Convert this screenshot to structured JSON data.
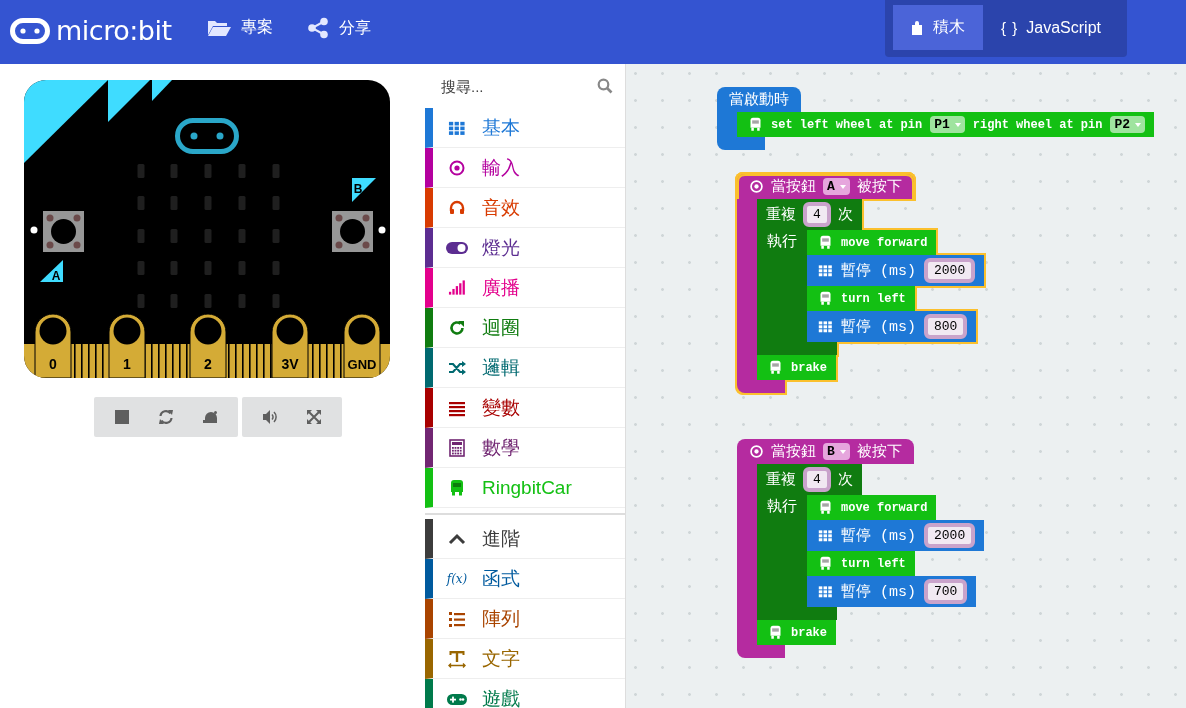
{
  "header": {
    "logo": "micro:bit",
    "menu": [
      {
        "kind": "folder",
        "label": "專案"
      },
      {
        "kind": "share",
        "label": "分享"
      }
    ],
    "editor_tabs": [
      {
        "kind": "blocks",
        "label": "積木",
        "selected": true
      },
      {
        "kind": "javascript",
        "icon_text": "{ }",
        "label": "JavaScript",
        "selected": false
      }
    ]
  },
  "simulator": {
    "buttons": [
      {
        "label": "A"
      },
      {
        "label": "B"
      }
    ],
    "pins": [
      "0",
      "1",
      "2",
      "3V",
      "GND"
    ],
    "toolbar_groups": [
      {
        "buttons": [
          {
            "kind": "stop"
          },
          {
            "kind": "restart"
          },
          {
            "kind": "slow"
          }
        ]
      },
      {
        "buttons": [
          {
            "kind": "sound"
          },
          {
            "kind": "fullscreen"
          }
        ]
      }
    ]
  },
  "toolbox": {
    "search": {
      "placeholder": "搜尋..."
    },
    "categories": [
      {
        "kind": "grid",
        "label": "基本",
        "color": "#1e78d6"
      },
      {
        "kind": "target",
        "label": "輸入",
        "color": "#b4009e"
      },
      {
        "kind": "headphones",
        "label": "音效",
        "color": "#d83b01"
      },
      {
        "kind": "toggle",
        "label": "燈光",
        "color": "#5c2d91"
      },
      {
        "kind": "signal",
        "label": "廣播",
        "color": "#e3008c"
      },
      {
        "kind": "refresh",
        "label": "迴圈",
        "color": "#107c10"
      },
      {
        "kind": "shuffle",
        "label": "邏輯",
        "color": "#006970"
      },
      {
        "kind": "lines",
        "label": "變數",
        "color": "#a80000"
      },
      {
        "kind": "calculator",
        "label": "數學",
        "color": "#712672"
      },
      {
        "kind": "car",
        "label": "RingbitCar",
        "color": "#13c013"
      }
    ],
    "advanced": [
      {
        "kind": "chevron",
        "label": "進階",
        "color": "#3c3c3c"
      },
      {
        "kind": "function",
        "icon_text": "f(x)",
        "label": "函式",
        "color": "#005a9e"
      },
      {
        "kind": "list",
        "label": "陣列",
        "color": "#a94400"
      },
      {
        "kind": "text",
        "label": "文字",
        "color": "#996600"
      },
      {
        "kind": "gamepad",
        "label": "遊戲",
        "color": "#007a4b"
      }
    ]
  },
  "workspace": {
    "scripts": [
      {
        "kind": "start_hat",
        "selected": false,
        "header": [
          {
            "kind": "text",
            "value": "當啟動時"
          }
        ],
        "body": [
          {
            "kind": "car_block",
            "parts": [
              {
                "kind": "text",
                "value": "set left wheel at pin"
              },
              {
                "kind": "dropdown",
                "value": "P1"
              },
              {
                "kind": "text",
                "value": "right wheel at pin"
              },
              {
                "kind": "dropdown",
                "value": "P2"
              }
            ]
          }
        ]
      },
      {
        "kind": "button_hat",
        "selected": true,
        "header": [
          {
            "kind": "text",
            "value": "當按鈕"
          },
          {
            "kind": "dropdown",
            "value": "A"
          },
          {
            "kind": "text",
            "value": "被按下"
          }
        ],
        "body": [
          {
            "kind": "loop",
            "header": [
              {
                "kind": "text",
                "value": "重複"
              },
              {
                "kind": "number",
                "value": "4"
              },
              {
                "kind": "text",
                "value": "次"
              }
            ],
            "do_label": "執行",
            "body": [
              {
                "kind": "car_block",
                "parts": [
                  {
                    "kind": "text",
                    "value": "move forward"
                  }
                ]
              },
              {
                "kind": "basic_block",
                "parts": [
                  {
                    "kind": "text",
                    "value": "暫停 (ms)"
                  },
                  {
                    "kind": "number",
                    "value": "2000"
                  }
                ]
              },
              {
                "kind": "car_block",
                "parts": [
                  {
                    "kind": "text",
                    "value": "turn left"
                  }
                ]
              },
              {
                "kind": "basic_block",
                "parts": [
                  {
                    "kind": "text",
                    "value": "暫停 (ms)"
                  },
                  {
                    "kind": "number",
                    "value": "800"
                  }
                ]
              }
            ]
          },
          {
            "kind": "car_block",
            "parts": [
              {
                "kind": "text",
                "value": "brake"
              }
            ]
          }
        ]
      },
      {
        "kind": "button_hat",
        "selected": false,
        "header": [
          {
            "kind": "text",
            "value": "當按鈕"
          },
          {
            "kind": "dropdown",
            "value": "B"
          },
          {
            "kind": "text",
            "value": "被按下"
          }
        ],
        "body": [
          {
            "kind": "loop",
            "header": [
              {
                "kind": "text",
                "value": "重複"
              },
              {
                "kind": "number",
                "value": "4"
              },
              {
                "kind": "text",
                "value": "次"
              }
            ],
            "do_label": "執行",
            "body": [
              {
                "kind": "car_block",
                "parts": [
                  {
                    "kind": "text",
                    "value": "move forward"
                  }
                ]
              },
              {
                "kind": "basic_block",
                "parts": [
                  {
                    "kind": "text",
                    "value": "暫停 (ms)"
                  },
                  {
                    "kind": "number",
                    "value": "2000"
                  }
                ]
              },
              {
                "kind": "car_block",
                "parts": [
                  {
                    "kind": "text",
                    "value": "turn left"
                  }
                ]
              },
              {
                "kind": "basic_block",
                "parts": [
                  {
                    "kind": "text",
                    "value": "暫停 (ms)"
                  },
                  {
                    "kind": "number",
                    "value": "700"
                  }
                ]
              }
            ]
          },
          {
            "kind": "car_block",
            "parts": [
              {
                "kind": "text",
                "value": "brake"
              }
            ]
          }
        ]
      }
    ]
  }
}
